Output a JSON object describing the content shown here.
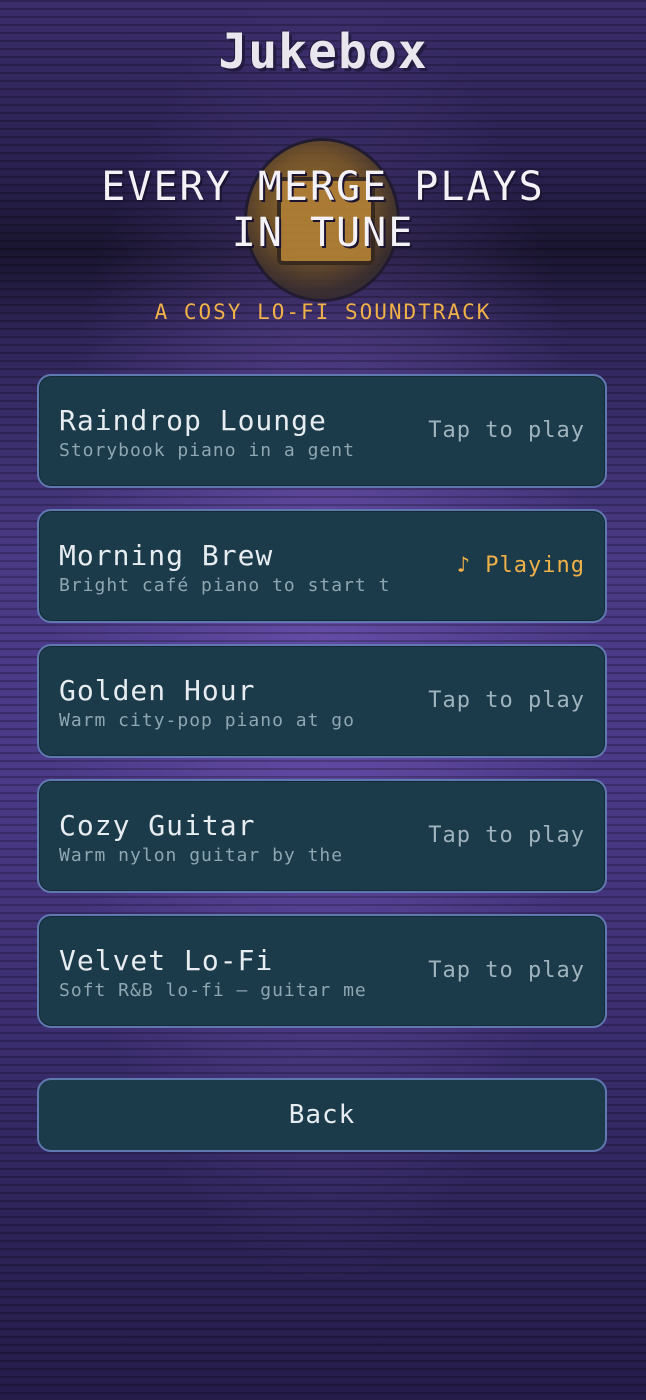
{
  "header": {
    "title": "Jukebox"
  },
  "hero": {
    "headline_line1": "EVERY MERGE PLAYS",
    "headline_line2": "IN TUNE",
    "subheadline": "A COSY LO-FI SOUNDTRACK"
  },
  "tracks": [
    {
      "name": "Raindrop Lounge",
      "description": "Storybook piano in a gent",
      "status": "Tap to play",
      "playing": false
    },
    {
      "name": "Morning Brew",
      "description": "Bright café piano to start t",
      "status": "♪ Playing",
      "playing": true
    },
    {
      "name": "Golden Hour",
      "description": "Warm city-pop piano at go",
      "status": "Tap to play",
      "playing": false
    },
    {
      "name": "Cozy Guitar",
      "description": "Warm nylon guitar by the",
      "status": "Tap to play",
      "playing": false
    },
    {
      "name": "Velvet Lo-Fi",
      "description": "Soft R&B lo-fi — guitar me",
      "status": "Tap to play",
      "playing": false
    }
  ],
  "footer": {
    "back_label": "Back"
  },
  "colors": {
    "accent": "#f0b148",
    "card_bg": "#1b3a4a",
    "card_border": "#5f79b0",
    "background": "#3b2d6b"
  }
}
